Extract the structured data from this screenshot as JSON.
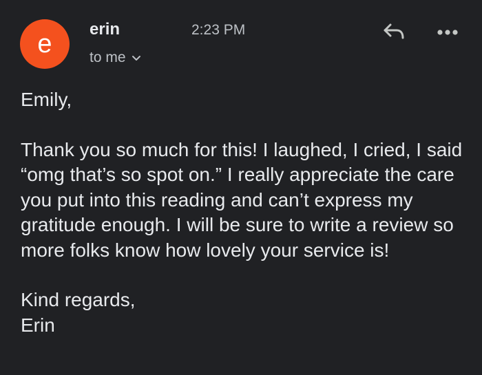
{
  "sender": {
    "avatar_letter": "e",
    "avatar_color": "#f4511e",
    "name": "erin",
    "time": "2:23 PM",
    "recipient_label": "to me"
  },
  "icons": {
    "expand_recipients": "chevron-down-icon",
    "reply": "reply-icon",
    "more": "more-horizontal-icon"
  },
  "message": {
    "greeting": "Emily,",
    "body": "Thank you so much for this! I laughed, I cried, I said “omg that’s so spot on.” I really appreciate the care you put into this reading and can’t express my gratitude enough. I will be sure to write a review so more folks know how lovely your service is!",
    "closing": "Kind regards,",
    "signature": "Erin"
  },
  "colors": {
    "background": "#202124",
    "primary_text": "#e8eaed",
    "secondary_text": "#bdc1c6"
  }
}
